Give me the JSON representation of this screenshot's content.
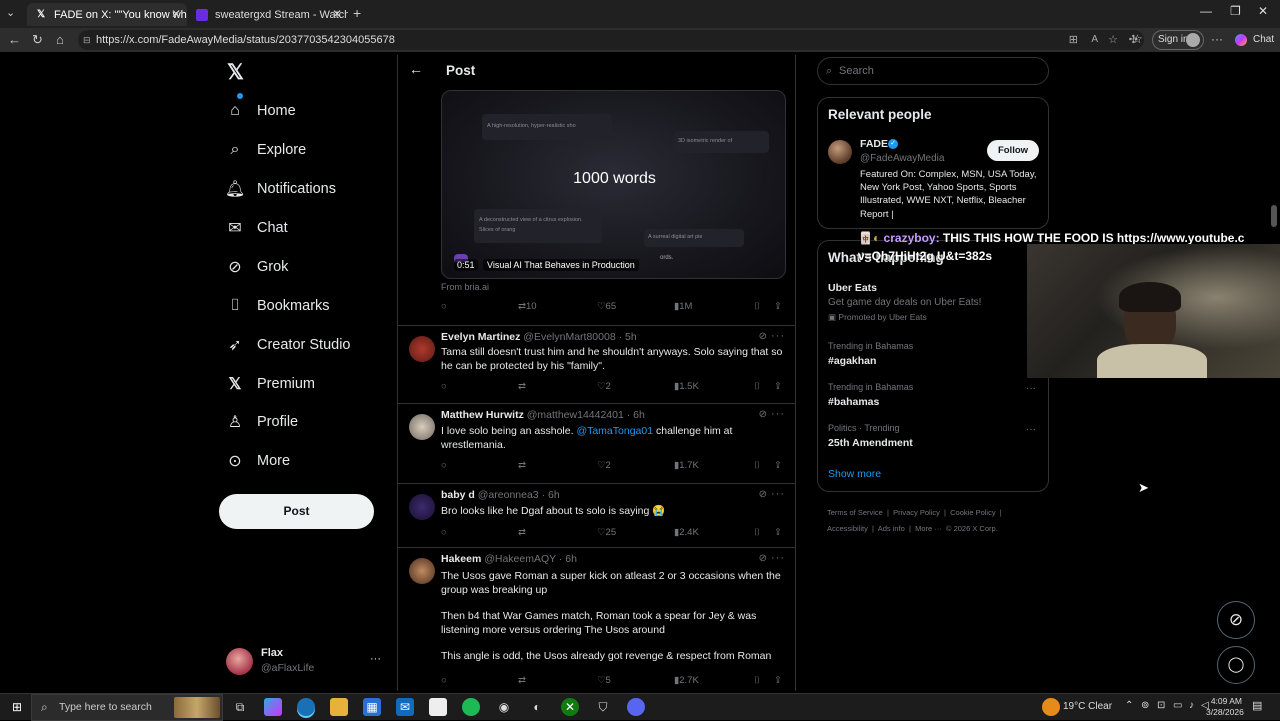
{
  "browser": {
    "tabs": [
      {
        "label": "FADE on X: \"\"You know who have"
      },
      {
        "label": "sweatergxd Stream - Watch Live o"
      }
    ],
    "url": "https://x.com/FadeAwayMedia/status/2037703542304055678",
    "signin_label": "Sign in",
    "chat_label": "Chat"
  },
  "nav": {
    "items": [
      {
        "label": "Home"
      },
      {
        "label": "Explore"
      },
      {
        "label": "Notifications"
      },
      {
        "label": "Chat"
      },
      {
        "label": "Grok"
      },
      {
        "label": "Bookmarks"
      },
      {
        "label": "Creator Studio"
      },
      {
        "label": "Premium"
      },
      {
        "label": "Profile"
      },
      {
        "label": "More"
      }
    ],
    "post_label": "Post",
    "user": {
      "name": "Flax",
      "handle": "@aFlaxLife"
    }
  },
  "header": {
    "title": "Post"
  },
  "video": {
    "headline": "1000 words",
    "snippet_1": "A high-resolution, hyper-realistic sho",
    "snippet_2": "3D isometric render of",
    "snippet_3": "A deconstructed view of a citrus explosion. Slices of orang",
    "snippet_4": "A surreal digital art pie",
    "snippet_5": "ords.",
    "timestamp": "0:51",
    "caption": "Visual AI That Behaves in Production",
    "source": "From bria.ai"
  },
  "main_post_stats": {
    "retweets": "10",
    "likes": "65",
    "views": "1M"
  },
  "replies": [
    {
      "name": "Evelyn Martinez",
      "handle": "@EvelynMart80008",
      "time": "· 5h",
      "text": "Tama still doesn't trust him and he shouldn't anyways. Solo saying that so he can be protected by his \"family\".",
      "likes": "2",
      "views": "1.5K"
    },
    {
      "name": "Matthew Hurwitz",
      "handle": "@matthew14442401",
      "time": "· 6h",
      "text_before": "I love solo being an asshole. ",
      "mention": "@TamaTonga01",
      "text_after": " challenge him at wrestlemania.",
      "likes": "2",
      "views": "1.7K"
    },
    {
      "name": "baby d",
      "handle": "@areonnea3",
      "time": "· 6h",
      "text": "Bro looks like he Dgaf about ts solo is saying 😭",
      "likes": "25",
      "views": "2.4K"
    },
    {
      "name": "Hakeem",
      "handle": "@HakeemAQY",
      "time": "· 6h",
      "para1": "The Usos gave Roman a super kick on atleast 2 or 3 occasions when the group was breaking up",
      "para2": "Then b4 that War Games match, Roman took a spear for Jey & was listening more versus ordering The Usos around",
      "para3": "This angle is odd,  the Usos already got revenge & respect from Roman",
      "likes": "5",
      "views": "2.7K"
    }
  ],
  "right": {
    "search_placeholder": "Search",
    "relevant": {
      "title": "Relevant people",
      "name": "FADE",
      "handle": "@FadeAwayMedia",
      "follow_label": "Follow",
      "bio": "Featured On: Complex, MSN, USA Today, New York Post, Yahoo Sports, Sports Illustrated, WWE NXT, Netflix, Bleacher Report |"
    },
    "happening_title": "What's happening",
    "promo": {
      "title": "Uber Eats",
      "text": "Get game day deals on Uber Eats!",
      "promoted": "Promoted by Uber Eats"
    },
    "trends": [
      {
        "context": "Trending in Bahamas",
        "name": "#agakhan"
      },
      {
        "context": "Trending in Bahamas",
        "name": "#bahamas"
      },
      {
        "context": "Politics · Trending",
        "name": "25th Amendment"
      }
    ],
    "show_more": "Show more",
    "footer": [
      "Terms of Service",
      "Privacy Policy",
      "Cookie Policy",
      "Accessibility",
      "Ads info",
      "More ···",
      "© 2026 X Corp."
    ]
  },
  "overlay": {
    "chat_user": "crazyboy:",
    "chat_text": "THIS THIS HOW THE FOOD IS https://www.youtube.c",
    "chat_text2": "v=Qh7HiHt2g U&t=382s"
  },
  "taskbar": {
    "search_placeholder": "Type here to search",
    "weather": "19°C  Clear",
    "time": "4:09 AM",
    "date": "3/28/2026"
  },
  "colors": {
    "accent": "#1d9bf0",
    "background": "#000000",
    "border": "#2f3336",
    "muted": "#71767b"
  }
}
